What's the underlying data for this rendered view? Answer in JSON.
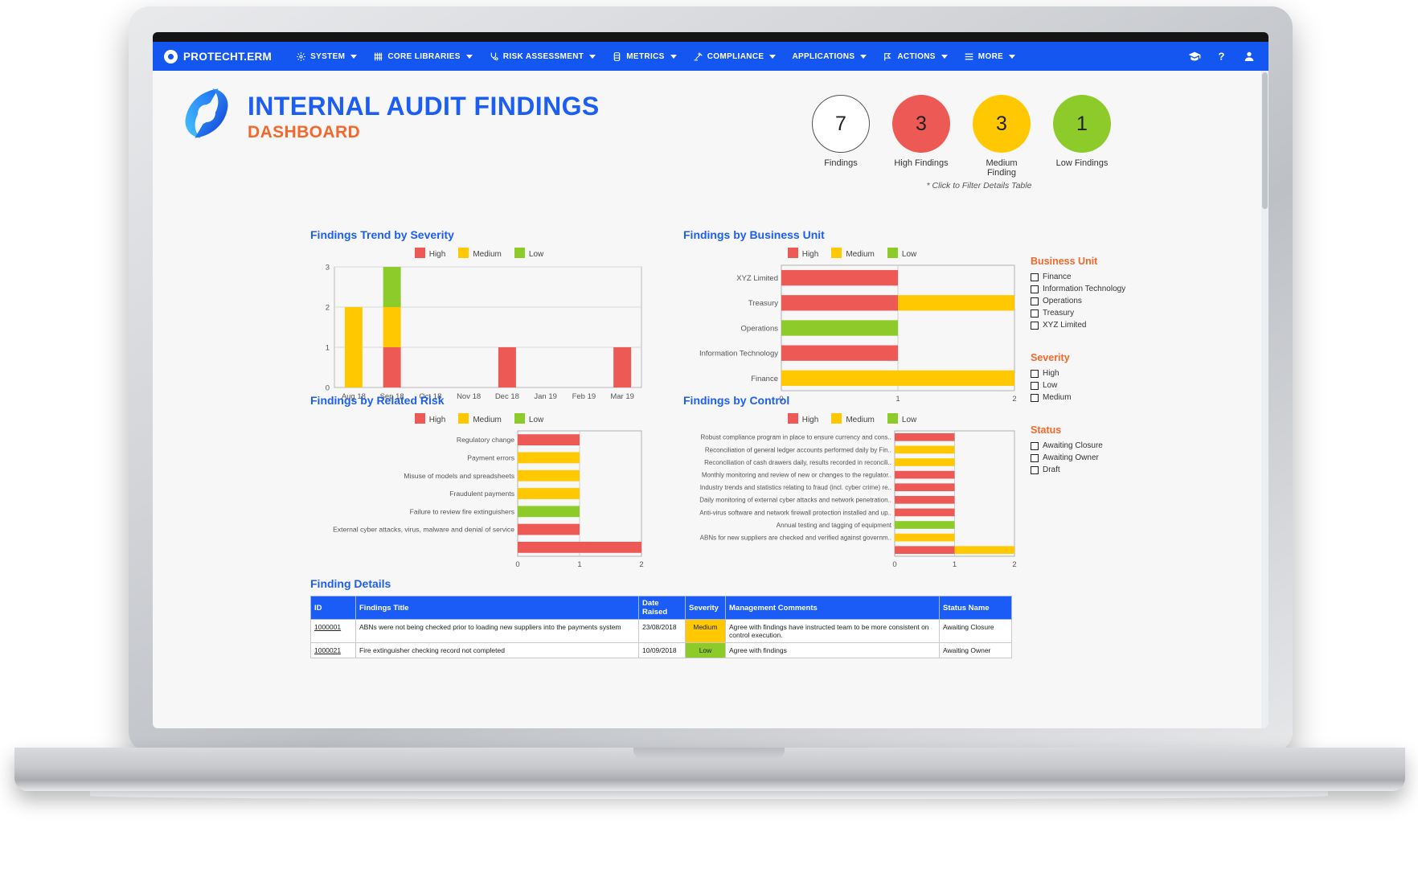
{
  "nav": {
    "brand": "PROTECHT.ERM",
    "items": [
      {
        "label": "SYSTEM",
        "icon": "gear-icon",
        "caret": true
      },
      {
        "label": "CORE LIBRARIES",
        "icon": "library-icon",
        "caret": true
      },
      {
        "label": "RISK ASSESSMENT",
        "icon": "stethoscope-icon",
        "caret": true
      },
      {
        "label": "METRICS",
        "icon": "metrics-icon",
        "caret": true
      },
      {
        "label": "COMPLIANCE",
        "icon": "gavel-icon",
        "caret": true
      },
      {
        "label": "APPLICATIONS",
        "icon": "",
        "caret": true
      },
      {
        "label": "ACTIONS",
        "icon": "flag-icon",
        "caret": true
      },
      {
        "label": "MORE",
        "icon": "hamburger-icon",
        "caret": true
      }
    ],
    "right_icons": [
      "graduation-cap-icon",
      "help-icon",
      "user-icon"
    ]
  },
  "header": {
    "title_line1": "INTERNAL AUDIT FINDINGS",
    "title_line2": "DASHBOARD",
    "note": "* Click to Filter Details Table",
    "kpis": [
      {
        "value": "7",
        "label": "Findings",
        "color": "#ffffff",
        "border": "#555555",
        "text": "#222222"
      },
      {
        "value": "3",
        "label": "High Findings",
        "color": "#ed5a55",
        "border": "#ed5a55",
        "text": "#222222"
      },
      {
        "value": "3",
        "label": "Medium Finding",
        "color": "#ffc800",
        "border": "#ffc800",
        "text": "#222222"
      },
      {
        "value": "1",
        "label": "Low Findings",
        "color": "#8ccb2a",
        "border": "#8ccb2a",
        "text": "#222222"
      }
    ]
  },
  "colors": {
    "high": "#ed5a55",
    "medium": "#ffc800",
    "low": "#8ccb2a",
    "accent_blue": "#1d5ef2",
    "accent_orange": "#f4682a"
  },
  "legend": {
    "high": "High",
    "medium": "Medium",
    "low": "Low"
  },
  "panels": {
    "trend": "Findings Trend by Severity",
    "business_unit": "Findings by Business Unit",
    "related_risk": "Findings by Related Risk",
    "control": "Findings by Control"
  },
  "filters": {
    "business_unit": {
      "title": "Business Unit",
      "options": [
        "Finance",
        "Information Technology",
        "Operations",
        "Treasury",
        "XYZ Limited"
      ]
    },
    "severity": {
      "title": "Severity",
      "options": [
        "High",
        "Low",
        "Medium"
      ]
    },
    "status": {
      "title": "Status",
      "options": [
        "Awaiting Closure",
        "Awaiting Owner",
        "Draft"
      ]
    }
  },
  "table": {
    "title": "Finding Details",
    "columns": [
      "ID",
      "Findings Title",
      "Date Raised",
      "Severity",
      "Management Comments",
      "Status Name"
    ],
    "rows": [
      {
        "id": "1000001",
        "title": "ABNs were not being checked prior to loading new suppliers into the payments system",
        "date": "23/08/2018",
        "severity": "Medium",
        "comments": "Agree with findings have instructed team to be more consistent on control execution.",
        "status": "Awaiting Closure"
      },
      {
        "id": "1000021",
        "title": "Fire extinguisher checking record not completed",
        "date": "10/09/2018",
        "severity": "Low",
        "comments": "Agree with findings",
        "status": "Awaiting Owner"
      }
    ]
  },
  "chart_data": [
    {
      "type": "bar",
      "title": "Findings Trend by Severity",
      "orientation": "vertical",
      "stacked": true,
      "categories": [
        "Aug 18",
        "Sep 18",
        "Oct 18",
        "Nov 18",
        "Dec 18",
        "Jan 19",
        "Feb 19",
        "Mar 19"
      ],
      "series": [
        {
          "name": "High",
          "color": "#ed5a55",
          "values": [
            0,
            1,
            0,
            0,
            1,
            0,
            0,
            1
          ]
        },
        {
          "name": "Medium",
          "color": "#ffc800",
          "values": [
            2,
            1,
            0,
            0,
            0,
            0,
            0,
            0
          ]
        },
        {
          "name": "Low",
          "color": "#8ccb2a",
          "values": [
            0,
            1,
            0,
            0,
            0,
            0,
            0,
            0
          ]
        }
      ],
      "ylim": [
        0,
        3
      ],
      "yticks": [
        0,
        1,
        2,
        3
      ],
      "xlabel": "",
      "ylabel": "",
      "grid": true,
      "legend_position": "top"
    },
    {
      "type": "bar",
      "title": "Findings by Business Unit",
      "orientation": "horizontal",
      "stacked": true,
      "categories": [
        "XYZ Limited",
        "Treasury",
        "Operations",
        "Information Technology",
        "Finance"
      ],
      "series": [
        {
          "name": "High",
          "color": "#ed5a55",
          "values": [
            1,
            1,
            0,
            1,
            0
          ]
        },
        {
          "name": "Medium",
          "color": "#ffc800",
          "values": [
            0,
            1,
            0,
            0,
            2
          ]
        },
        {
          "name": "Low",
          "color": "#8ccb2a",
          "values": [
            0,
            0,
            1,
            0,
            0
          ]
        }
      ],
      "xlim": [
        0,
        2
      ],
      "xticks": [
        0,
        1,
        2
      ],
      "grid": true,
      "legend_position": "top"
    },
    {
      "type": "bar",
      "title": "Findings by Related Risk",
      "orientation": "horizontal",
      "stacked": true,
      "categories": [
        "Regulatory change",
        "Payment errors",
        "Misuse of models and spreadsheets",
        "Fraudulent payments",
        "Failure to review fire extinguishers",
        "External cyber attacks, virus, malware and denial of service",
        ""
      ],
      "series": [
        {
          "name": "High",
          "color": "#ed5a55",
          "values": [
            1,
            0,
            0,
            0,
            0,
            1,
            2
          ]
        },
        {
          "name": "Medium",
          "color": "#ffc800",
          "values": [
            0,
            1,
            1,
            1,
            0,
            0,
            0
          ]
        },
        {
          "name": "Low",
          "color": "#8ccb2a",
          "values": [
            0,
            0,
            0,
            0,
            1,
            0,
            0
          ]
        }
      ],
      "xlim": [
        0,
        2
      ],
      "xticks": [
        0,
        1,
        2
      ],
      "grid": true,
      "legend_position": "top"
    },
    {
      "type": "bar",
      "title": "Findings by Control",
      "orientation": "horizontal",
      "stacked": true,
      "categories": [
        "Robust compliance program in place to ensure currency and cons..",
        "Reconciliation of general ledger accounts performed daily by Fin..",
        "Reconciliation of cash drawers daily, results recorded in reconcili..",
        "Monthly monitoring and review of new or changes to the regulator..",
        "Industry trends and statistics relating to fraud (incl. cyber crime) re..",
        "Daily monitoring of external cyber attacks and network penetration..",
        "Anti-virus software and network firewall protection installed and up..",
        "Annual testing and tagging of equipment",
        "ABNs for new suppliers are checked and verified against governm..",
        ""
      ],
      "series": [
        {
          "name": "High",
          "color": "#ed5a55",
          "values": [
            1,
            0,
            0,
            1,
            1,
            1,
            1,
            0,
            0,
            1
          ]
        },
        {
          "name": "Medium",
          "color": "#ffc800",
          "values": [
            0,
            1,
            1,
            0,
            0,
            0,
            0,
            0,
            1,
            1
          ]
        },
        {
          "name": "Low",
          "color": "#8ccb2a",
          "values": [
            0,
            0,
            0,
            0,
            0,
            0,
            0,
            1,
            0,
            0
          ]
        }
      ],
      "xlim": [
        0,
        2
      ],
      "xticks": [
        0,
        1,
        2
      ],
      "grid": true,
      "legend_position": "top"
    }
  ]
}
